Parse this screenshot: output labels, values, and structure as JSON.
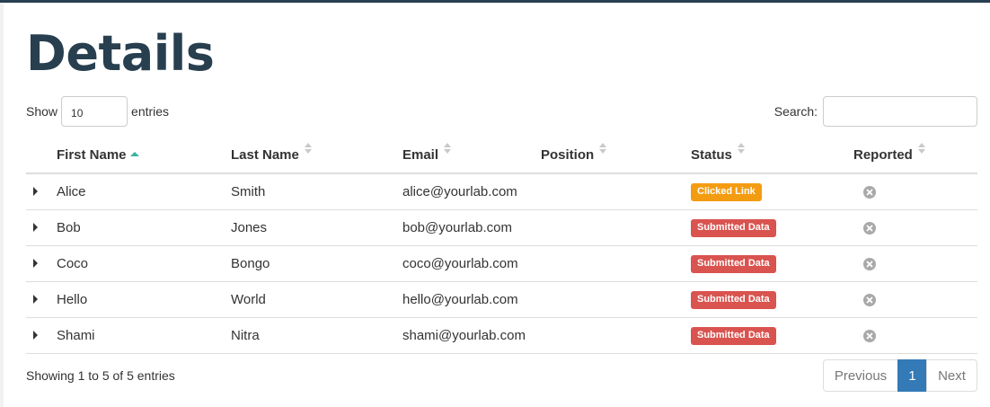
{
  "page": {
    "title": "Details"
  },
  "length": {
    "show_label": "Show",
    "value": "10",
    "entries_label": "entries"
  },
  "search": {
    "label": "Search:",
    "value": ""
  },
  "table": {
    "columns": [
      "First Name",
      "Last Name",
      "Email",
      "Position",
      "Status",
      "Reported"
    ],
    "sorted_column": "First Name",
    "sort_direction": "ascending",
    "rows": [
      {
        "first": "Alice",
        "last": "Smith",
        "email": "alice@yourlab.com",
        "position": "",
        "status": "Clicked Link",
        "status_color": "#f39c12",
        "reported_icon": "x-circle-icon"
      },
      {
        "first": "Bob",
        "last": "Jones",
        "email": "bob@yourlab.com",
        "position": "",
        "status": "Submitted Data",
        "status_color": "#d9534f",
        "reported_icon": "x-circle-icon"
      },
      {
        "first": "Coco",
        "last": "Bongo",
        "email": "coco@yourlab.com",
        "position": "",
        "status": "Submitted Data",
        "status_color": "#d9534f",
        "reported_icon": "x-circle-icon"
      },
      {
        "first": "Hello",
        "last": "World",
        "email": "hello@yourlab.com",
        "position": "",
        "status": "Submitted Data",
        "status_color": "#d9534f",
        "reported_icon": "x-circle-icon"
      },
      {
        "first": "Shami",
        "last": "Nitra",
        "email": "shami@yourlab.com",
        "position": "",
        "status": "Submitted Data",
        "status_color": "#d9534f",
        "reported_icon": "x-circle-icon"
      }
    ]
  },
  "info": {
    "text": "Showing 1 to 5 of 5 entries"
  },
  "pagination": {
    "previous": "Previous",
    "current": "1",
    "next": "Next"
  },
  "colors": {
    "accent": "#337ab7",
    "title": "#283f50",
    "sort_active": "#37b3a4"
  }
}
